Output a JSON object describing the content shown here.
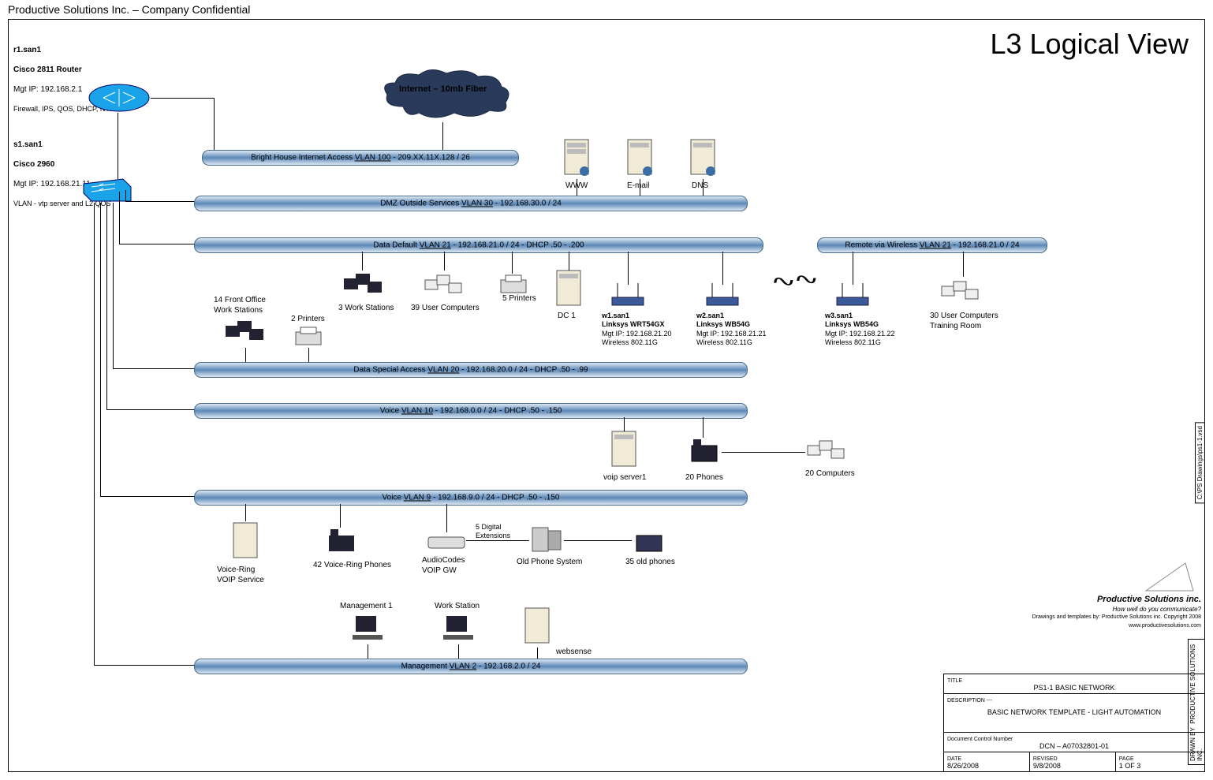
{
  "header": "Productive Solutions Inc. – Company Confidential",
  "title": "L3 Logical View",
  "router": {
    "name": "r1.san1",
    "model": "Cisco 2811 Router",
    "mgmt": "Mgt IP: 192.168.2.1",
    "services": "Firewall, IPS, QOS, DHCP, NTP"
  },
  "switch": {
    "name": "s1.san1",
    "model": "Cisco 2960",
    "mgmt": "Mgt IP: 192.168.21.11",
    "services": "VLAN - vtp server and L2 QOS"
  },
  "cloud": "Internet – 10mb Fiber",
  "vlans": {
    "v100": {
      "pre": "Bright House Internet Access ",
      "vl": "VLAN 100",
      "post": " - 209.XX.11X.128 / 26"
    },
    "v30": {
      "pre": "DMZ Outside Services ",
      "vl": "VLAN 30",
      "post": " - 192.168.30.0 / 24"
    },
    "v21": {
      "pre": "Data Default ",
      "vl": "VLAN 21",
      "post": " - 192.168.21.0 / 24  - DHCP .50 - .200"
    },
    "v21r": {
      "pre": "Remote via Wireless ",
      "vl": "VLAN 21",
      "post": " - 192.168.21.0 / 24"
    },
    "v20": {
      "pre": "Data Special Access ",
      "vl": "VLAN 20",
      "post": " - 192.168.20.0 / 24  - DHCP .50 - .99"
    },
    "v10": {
      "pre": "Voice ",
      "vl": "VLAN 10",
      "post": " - 192.168.0.0 / 24  - DHCP .50 - .150"
    },
    "v9": {
      "pre": "Voice ",
      "vl": "VLAN 9",
      "post": " - 192.168.9.0 / 24  - DHCP .50 - .150"
    },
    "v2": {
      "pre": "Management ",
      "vl": "VLAN 2",
      "post": " - 192.168.2.0 / 24"
    }
  },
  "dmz": {
    "www": "WWW",
    "email": "E-mail",
    "dns": "DNS"
  },
  "data21": {
    "wk14": "14 Front Office\nWork Stations",
    "p2": "2 Printers",
    "wk3": "3 Work Stations",
    "uc39": "39 User Computers",
    "p5": "5 Printers",
    "dc1": "DC 1",
    "w1": {
      "name": "w1.san1",
      "model": "Linksys WRT54GX",
      "mgmt": "Mgt IP: 192.168.21.20",
      "wl": "Wireless 802.11G"
    },
    "w2": {
      "name": "w2.san1",
      "model": "Linksys WB54G",
      "mgmt": "Mgt IP: 192.168.21.21",
      "wl": "Wireless 802.11G"
    },
    "w3": {
      "name": "w3.san1",
      "model": "Linksys WB54G",
      "mgmt": "Mgt IP: 192.168.21.22",
      "wl": "Wireless 802.11G"
    },
    "uc30": "30 User Computers\nTraining Room"
  },
  "voice10": {
    "voip": "voip server1",
    "ph20": "20 Phones",
    "c20": "20 Computers"
  },
  "voice9": {
    "vr": "Voice-Ring\nVOIP Service",
    "ph42": "42 Voice-Ring Phones",
    "ac": "AudioCodes\nVOIP GW",
    "ext5": "5 Digital\nExtensions",
    "old": "Old Phone System",
    "ph35": "35 old phones"
  },
  "mgmt": {
    "m1": "Management 1",
    "ws": "Work Station",
    "web": "websense"
  },
  "logo": {
    "brand": "Productive\nSolutions inc.",
    "tag": "How well do you communicate?",
    "credit": "Drawings and templates by: Productive Solutions inc. Copyright 2008\nwww.productivesolutions.com"
  },
  "titleblock": {
    "titleLbl": "TITLE",
    "title": "PS1-1 BASIC NETWORK",
    "descLbl": "DESCRIPTION  ---",
    "desc": "BASIC NETWORK TEMPLATE - LIGHT AUTOMATION",
    "dcnLbl": "Document Control Number",
    "dcn": "DCN – A07032801-01",
    "dateLbl": "DATE",
    "date": "8/26/2008",
    "revLbl": "REVISED",
    "rev": "9/8/2008",
    "pageLbl": "PAGE",
    "page": "1 OF 3",
    "drawnby": "DRAWN BY",
    "company": "PRODUCTIVE SOLUTIONS INC.",
    "path": "C:\\PS Drawings\\ps1-1.vsd"
  }
}
